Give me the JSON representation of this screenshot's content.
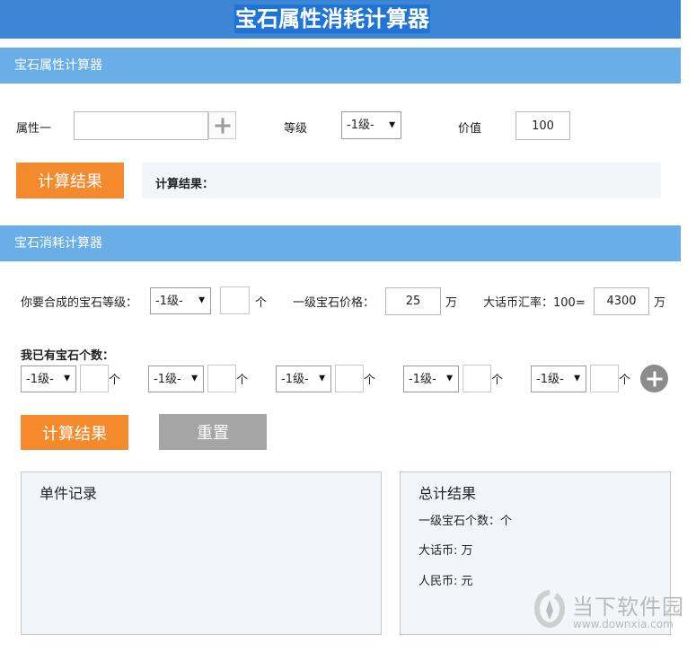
{
  "header": {
    "title": "宝石属性消耗计算器"
  },
  "attr_calc": {
    "section_title": "宝石属性计算器",
    "attr_label": "属性一",
    "attr_value": "",
    "level_label": "等级",
    "level_value": "-1级-",
    "price_label": "价值",
    "price_value": "100",
    "calc_button": "计算结果",
    "result_label": "计算结果："
  },
  "consume_calc": {
    "section_title": "宝石消耗计算器",
    "target_label": "你要合成的宝石等级：",
    "target_level": "-1级-",
    "target_count": "",
    "unit_ge": "个",
    "price_label": "一级宝石价格：",
    "price_value": "25",
    "unit_wan": "万",
    "rate_label": "大话币汇率：100=",
    "rate_value": "4300",
    "owned_label": "我已有宝石个数：",
    "owned": [
      {
        "level": "-1级-",
        "count": ""
      },
      {
        "level": "-1级-",
        "count": ""
      },
      {
        "level": "-1级-",
        "count": ""
      },
      {
        "level": "-1级-",
        "count": ""
      },
      {
        "level": "-1级-",
        "count": ""
      }
    ],
    "calc_button": "计算结果",
    "reset_button": "重置"
  },
  "records": {
    "title": "单件记录"
  },
  "totals": {
    "title": "总计结果",
    "count_line": "一级宝石个数：个",
    "dhb_line": "大话币: 万",
    "rmb_line": "人民币: 元"
  },
  "watermark": {
    "name": "当下软件园",
    "url": "www.downxia.com"
  }
}
